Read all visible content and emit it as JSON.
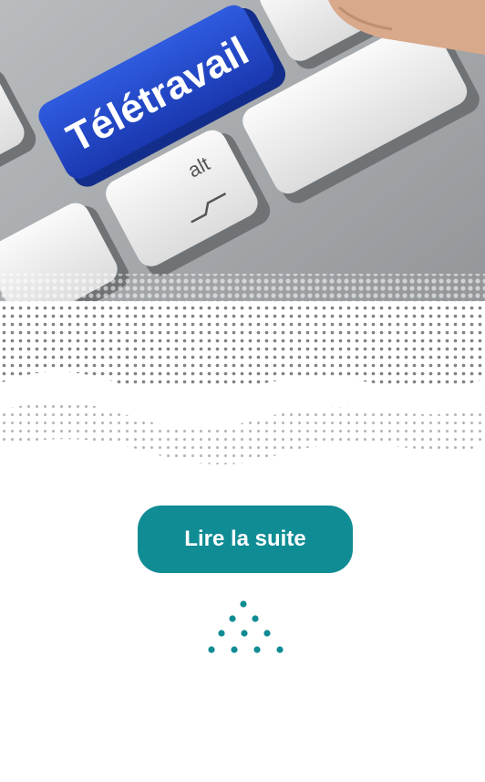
{
  "hero": {
    "key_label": "Télétravail",
    "alt_key_label": "alt",
    "brace_key_label": "{"
  },
  "cta": {
    "label": "Lire la suite"
  },
  "colors": {
    "accent": "#108c94",
    "key_blue": "#2146c9"
  },
  "decoration": {
    "icon": "dot-triangle-icon"
  }
}
